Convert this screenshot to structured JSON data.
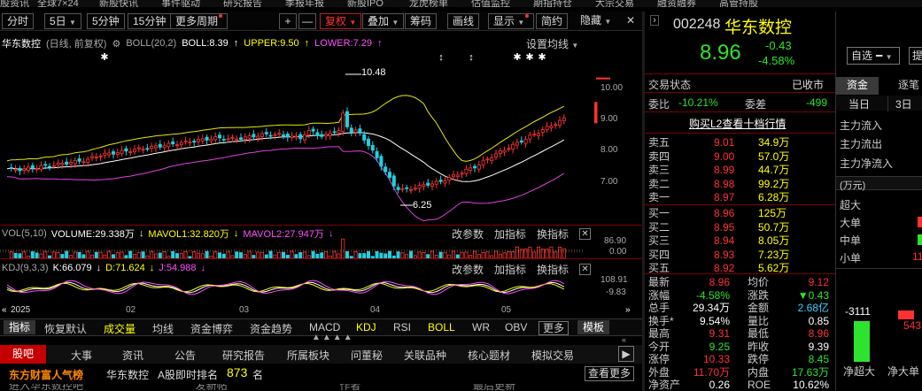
{
  "top_menu": [
    "股资讯",
    "全球7×24",
    "新股快讯",
    "事件驱动",
    "研究报告",
    "季报年报",
    "新股IPO",
    "龙虎榜单",
    "估值监控",
    "期指持仓",
    "大宗交易",
    "融资融券",
    "高管持股"
  ],
  "toolbar": {
    "items": [
      "分时",
      "5日",
      "5分钟",
      "15分钟",
      "更多周期",
      "+",
      "—",
      "复权",
      "叠加",
      "筹码",
      "画线",
      "显示",
      "简约",
      "隐藏"
    ],
    "active": "复权",
    "window_controls": [
      "─",
      "▭",
      "✕"
    ]
  },
  "price_chart": {
    "stock_name": "华东数控",
    "mode": "(日线, 前复权)",
    "indicator": "BOLL(20,2)",
    "boll": "BOLL:8.39",
    "upper": "UPPER:9.50",
    "lower": "LOWER:7.29",
    "settings": "设置均线",
    "high_label": "10.48",
    "low_label": "6.25",
    "y_ticks": [
      "10.00",
      "9.00",
      "8.00",
      "7.00"
    ]
  },
  "volume_panel": {
    "title": "VOL(5,10)",
    "volume": "VOLUME:29.338万",
    "mavol1": "MAVOL1:32.820万",
    "mavol2": "MAVOL2:27.947万",
    "y_ticks": [
      "86.90",
      "0.00"
    ],
    "buttons": [
      "改参数",
      "加指标",
      "换指标"
    ]
  },
  "kdj_panel": {
    "title": "KDJ(9,3,3)",
    "k": "K:66.079",
    "d": "D:71.624",
    "j": "J:54.988",
    "y_ticks": [
      "108.91",
      "-9.83"
    ],
    "buttons": [
      "改参数",
      "加指标",
      "换指标"
    ]
  },
  "date_axis": [
    "2025",
    "02",
    "03",
    "04",
    "05"
  ],
  "indicator_tabs": {
    "left": "指标",
    "items": [
      "恢复默认",
      "成交量",
      "均线",
      "资金博弈",
      "资金趋势",
      "MACD",
      "KDJ",
      "RSI",
      "BOLL",
      "WR",
      "OBV"
    ],
    "more": "更多",
    "right": "模板",
    "highlighted": [
      "成交量",
      "KDJ",
      "BOLL"
    ]
  },
  "info_tabs": {
    "items": [
      "股吧",
      "大事",
      "资讯",
      "公告",
      "研究报告",
      "所属板块",
      "问董秘",
      "关联品种",
      "核心题材",
      "模拟交易"
    ],
    "active": "股吧"
  },
  "popularity": {
    "title": "东方财富人气榜",
    "name": "华东数控",
    "label": "A股即时排名",
    "rank": "873",
    "unit": "名",
    "more": "查看更多"
  },
  "bottom_partial": "进入华东数控吧  发新帖  作者  最后更新",
  "quote": {
    "code": "002248",
    "name": "华东数控",
    "price": "8.96",
    "change": "-0.43",
    "change_pct": "-4.58%",
    "trade_status_label": "交易状态",
    "trade_status": "已收市",
    "weibi_label": "委比",
    "weibi": "-10.21%",
    "weicha_label": "委差",
    "weicha": "-499",
    "l2_link": "购买L2查看十档行情"
  },
  "order_book": {
    "sell": [
      {
        "l": "卖五",
        "p": "9.01",
        "v": "34.9万"
      },
      {
        "l": "卖四",
        "p": "9.00",
        "v": "57.0万"
      },
      {
        "l": "卖三",
        "p": "8.99",
        "v": "44.7万"
      },
      {
        "l": "卖二",
        "p": "8.98",
        "v": "99.2万"
      },
      {
        "l": "卖一",
        "p": "8.97",
        "v": "6.28万"
      }
    ],
    "buy": [
      {
        "l": "买一",
        "p": "8.96",
        "v": "125万"
      },
      {
        "l": "买二",
        "p": "8.95",
        "v": "50.7万"
      },
      {
        "l": "买三",
        "p": "8.94",
        "v": "8.05万"
      },
      {
        "l": "买四",
        "p": "8.93",
        "v": "7.23万"
      },
      {
        "l": "买五",
        "p": "8.92",
        "v": "5.62万"
      }
    ]
  },
  "stats": [
    {
      "l1": "最新",
      "v1": "8.96",
      "c1": "r",
      "l2": "均价",
      "v2": "9.12",
      "c2": "r"
    },
    {
      "l1": "涨幅",
      "v1": "-4.58%",
      "c1": "g",
      "l2": "涨跌",
      "v2": "▼0.43",
      "c2": "g"
    },
    {
      "l1": "总手",
      "v1": "29.34万",
      "c1": "w",
      "l2": "金额",
      "v2": "2.68亿",
      "c2": "c"
    },
    {
      "l1": "换手*",
      "v1": "9.54%",
      "c1": "w",
      "l2": "量比",
      "v2": "0.85",
      "c2": "w"
    },
    {
      "l1": "最高",
      "v1": "9.31",
      "c1": "r",
      "l2": "最低",
      "v2": "8.96",
      "c2": "r"
    },
    {
      "l1": "今开",
      "v1": "9.25",
      "c1": "g",
      "l2": "昨收",
      "v2": "9.39",
      "c2": "w"
    },
    {
      "l1": "涨停",
      "v1": "10.33",
      "c1": "r",
      "l2": "跌停",
      "v2": "8.45",
      "c2": "g"
    },
    {
      "l1": "外盘",
      "v1": "11.70万",
      "c1": "r",
      "l2": "内盘",
      "v2": "17.63万",
      "c2": "g"
    },
    {
      "l1": "净资产",
      "v1": "0.26",
      "c1": "w",
      "l2": "ROE",
      "v2": "10.62%",
      "c2": "w"
    }
  ],
  "side_panel": {
    "add_watch": "自选",
    "tabs": [
      "资金",
      "逐笔"
    ],
    "period_tabs": [
      "当日",
      "3日"
    ],
    "flows": [
      "主力流入",
      "主力流出",
      "主力净流入"
    ],
    "unit": "(万元)",
    "sizes": [
      "超大",
      "大单",
      "中单",
      "小单"
    ],
    "partial": "11",
    "bar_values": [
      "-3111",
      "543"
    ],
    "bar_labels": [
      "净超大",
      "净大单"
    ]
  },
  "colors": {
    "up": "#ff3232",
    "down": "#2ee32e",
    "boll_mid": "#ffffff",
    "boll_upper": "#e8e800",
    "boll_lower": "#e040e0",
    "accent": "#ffff00"
  }
}
